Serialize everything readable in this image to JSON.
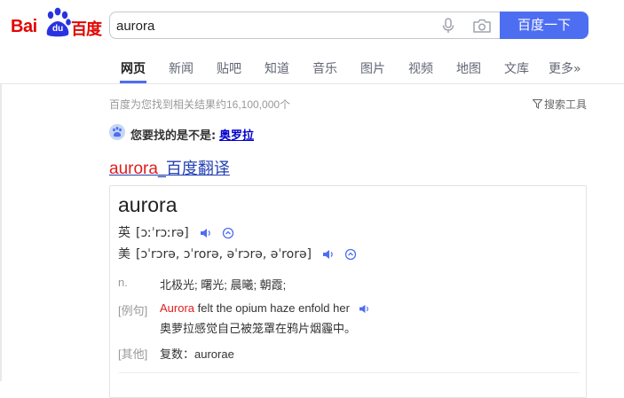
{
  "logo": {
    "bai": "Bai",
    "du": "du",
    "cn": "百度"
  },
  "search": {
    "value": "aurora",
    "button": "百度一下"
  },
  "tabs": [
    {
      "label": "网页",
      "active": true
    },
    {
      "label": "新闻"
    },
    {
      "label": "贴吧"
    },
    {
      "label": "知道"
    },
    {
      "label": "音乐"
    },
    {
      "label": "图片"
    },
    {
      "label": "视频"
    },
    {
      "label": "地图"
    },
    {
      "label": "文库"
    },
    {
      "label": "更多»"
    }
  ],
  "results": {
    "stats": "百度为您找到相关结果约16,100,000个",
    "tools": "搜索工具",
    "suggest_prefix": "您要找的是不是:",
    "suggest_term": "奥罗拉",
    "title_em": "aurora",
    "title_rest": "_百度翻译"
  },
  "dict": {
    "word": "aurora",
    "uk_label": "英",
    "uk_phon": "[ɔːˈrɔːrə]",
    "us_label": "美",
    "us_phon": "[ɔˈrɔrə, ɔˈrorə, əˈrɔrə, əˈrorə]",
    "pos_label": "n.",
    "pos_def": "北极光; 曙光; 晨曦; 朝霞;",
    "ex_label": "[例句]",
    "ex_word": "Aurora",
    "ex_rest": " felt the opium haze enfold her",
    "ex_trans": "奥萝拉感觉自己被笼罩在鸦片烟霾中。",
    "other_label": "[其他]",
    "other_value": "复数：aurorae"
  },
  "colors": {
    "brand_red": "#e10602",
    "brand_blue": "#4e6ef2",
    "link": "#2440b3",
    "suggest_link": "#0000cc"
  }
}
